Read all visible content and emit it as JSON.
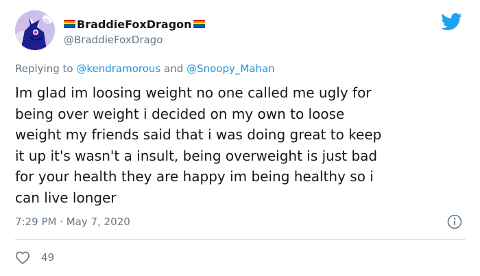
{
  "author": {
    "display_name": "BraddieFoxDragon",
    "handle": "@BraddieFoxDrago",
    "avatar_icon": "purple-fox-dragon-avatar",
    "flag_icon": "rainbow-flag-icon"
  },
  "reply": {
    "prefix": "Replying to",
    "mention_1": "@kendramorous",
    "joiner": "and",
    "mention_2": "@Snoopy_Mahan"
  },
  "body": {
    "lines": [
      "Im glad im loosing weight no one called me ugly for",
      "being over weight i decided on my own to loose",
      "weight my friends said that i was doing great to keep",
      "it up it's wasn't a insult, being overweight is just bad",
      "for your health they are happy im being healthy so i",
      "can live longer"
    ]
  },
  "meta": {
    "timestamp": "7:29 PM · May 7, 2020"
  },
  "actions": {
    "like_count": "49"
  },
  "colors": {
    "text": "#14171a",
    "secondary": "#657786",
    "link": "#1b95e0",
    "twitter_blue": "#1da1f2",
    "divider": "#cfd9de"
  },
  "icons": {
    "brand": "twitter-bird-icon",
    "info": "info-icon",
    "like": "heart-icon"
  }
}
